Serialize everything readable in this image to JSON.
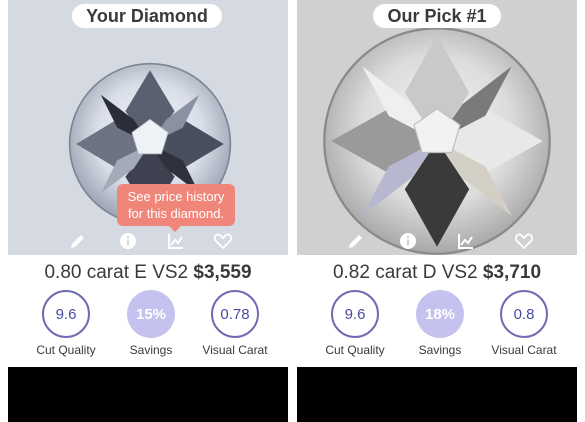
{
  "cards": [
    {
      "title": "Your Diamond",
      "tools": [
        {
          "icon": "pencil-icon"
        },
        {
          "icon": "info-icon"
        },
        {
          "icon": "chart-icon"
        },
        {
          "icon": "heart-icon"
        }
      ],
      "tooltip": {
        "line1": "See price history",
        "line2": "for this diamond."
      },
      "carat_text": "0.80 carat E VS2",
      "price": "$3,559",
      "metrics": [
        {
          "value": "9.6",
          "label": "Cut Quality"
        },
        {
          "value": "15%",
          "label": "Savings"
        },
        {
          "value": "0.78",
          "label": "Visual Carat"
        }
      ]
    },
    {
      "title": "Our Pick #1",
      "tools": [
        {
          "icon": "pencil-icon"
        },
        {
          "icon": "info-icon"
        },
        {
          "icon": "chart-icon"
        },
        {
          "icon": "heart-icon"
        }
      ],
      "carat_text": "0.82 carat D VS2",
      "price": "$3,710",
      "metrics": [
        {
          "value": "9.6",
          "label": "Cut Quality"
        },
        {
          "value": "18%",
          "label": "Savings"
        },
        {
          "value": "0.8",
          "label": "Visual Carat"
        }
      ]
    }
  ],
  "colors": {
    "accent_ring": "#6f6bb3",
    "savings_fill": "#c6c2ef",
    "tooltip_bg": "#f0857a"
  }
}
